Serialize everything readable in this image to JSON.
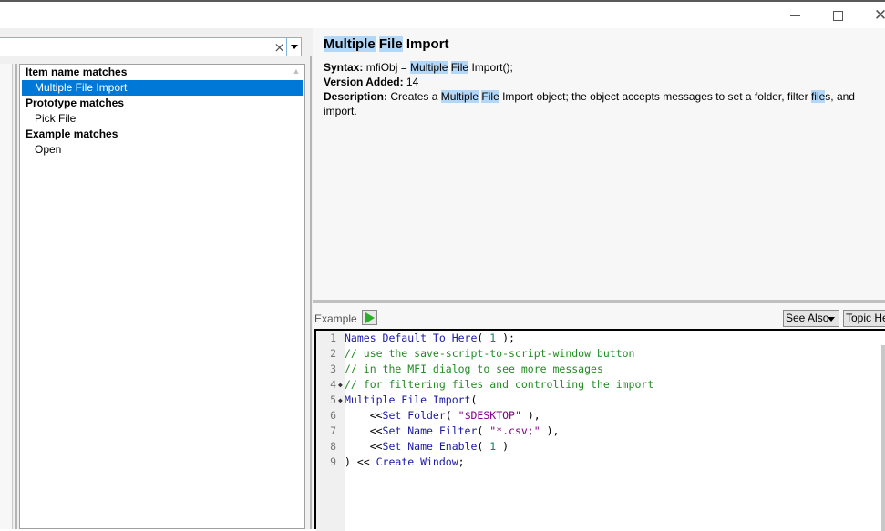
{
  "window": {
    "controls": {
      "minimize": "minimize",
      "maximize": "maximize",
      "close": "close"
    }
  },
  "search": {
    "value": "",
    "clear_icon": "×"
  },
  "results": {
    "groups": [
      {
        "header": "Item name matches",
        "items": [
          {
            "label": "Multiple File Import",
            "selected": true
          }
        ]
      },
      {
        "header": "Prototype matches",
        "items": [
          {
            "label": "Pick File",
            "selected": false
          }
        ]
      },
      {
        "header": "Example matches",
        "items": [
          {
            "label": "Open",
            "selected": false
          }
        ]
      }
    ]
  },
  "topic": {
    "title_parts": [
      "Multiple",
      "File",
      "Import"
    ],
    "syntax_label": "Syntax:",
    "syntax_pre": "mfiObj = ",
    "syntax_hl1": "Multiple",
    "syntax_hl2": "File",
    "syntax_post": " Import();",
    "version_label": "Version Added:",
    "version_value": "14",
    "description_label": "Description:",
    "description_pre": "Creates a ",
    "description_hl1": "Multiple",
    "description_hl2": "File",
    "description_mid": " Import object; the object accepts messages to set a folder, filter ",
    "description_hl3": "file",
    "description_post": "s, and import."
  },
  "example": {
    "label": "Example",
    "run_icon": "run-script",
    "see_also_label": "See Also",
    "topic_help_label": "Topic Help",
    "lines": [
      {
        "n": "1",
        "fold": "",
        "tokens": [
          {
            "t": "kw",
            "v": "Names Default To Here"
          },
          {
            "t": "pl",
            "v": "( "
          },
          {
            "t": "num",
            "v": "1"
          },
          {
            "t": "pl",
            "v": " );"
          }
        ]
      },
      {
        "n": "2",
        "fold": "",
        "tokens": [
          {
            "t": "cm",
            "v": "// use the save-script-to-script-window button"
          }
        ]
      },
      {
        "n": "3",
        "fold": "",
        "tokens": [
          {
            "t": "cm",
            "v": "// in the MFI dialog to see more messages"
          }
        ]
      },
      {
        "n": "4",
        "fold": "◆",
        "tokens": [
          {
            "t": "cm",
            "v": "// for filtering files and controlling the import"
          }
        ]
      },
      {
        "n": "5",
        "fold": "◆",
        "tokens": [
          {
            "t": "kw",
            "v": "Multiple File Import"
          },
          {
            "t": "pl",
            "v": "("
          }
        ]
      },
      {
        "n": "6",
        "fold": "",
        "tokens": [
          {
            "t": "pl",
            "v": "    <<"
          },
          {
            "t": "kw",
            "v": "Set Folder"
          },
          {
            "t": "pl",
            "v": "( "
          },
          {
            "t": "str",
            "v": "\"$DESKTOP\""
          },
          {
            "t": "pl",
            "v": " ),"
          }
        ]
      },
      {
        "n": "7",
        "fold": "",
        "tokens": [
          {
            "t": "pl",
            "v": "    <<"
          },
          {
            "t": "kw",
            "v": "Set Name Filter"
          },
          {
            "t": "pl",
            "v": "( "
          },
          {
            "t": "str",
            "v": "\"*.csv;\""
          },
          {
            "t": "pl",
            "v": " ),"
          }
        ]
      },
      {
        "n": "8",
        "fold": "",
        "tokens": [
          {
            "t": "pl",
            "v": "    <<"
          },
          {
            "t": "kw",
            "v": "Set Name Enable"
          },
          {
            "t": "pl",
            "v": "( "
          },
          {
            "t": "num",
            "v": "1"
          },
          {
            "t": "pl",
            "v": " )"
          }
        ]
      },
      {
        "n": "9",
        "fold": "",
        "tokens": [
          {
            "t": "pl",
            "v": ") << "
          },
          {
            "t": "kw",
            "v": "Create Window"
          },
          {
            "t": "pl",
            "v": ";"
          }
        ]
      }
    ]
  }
}
